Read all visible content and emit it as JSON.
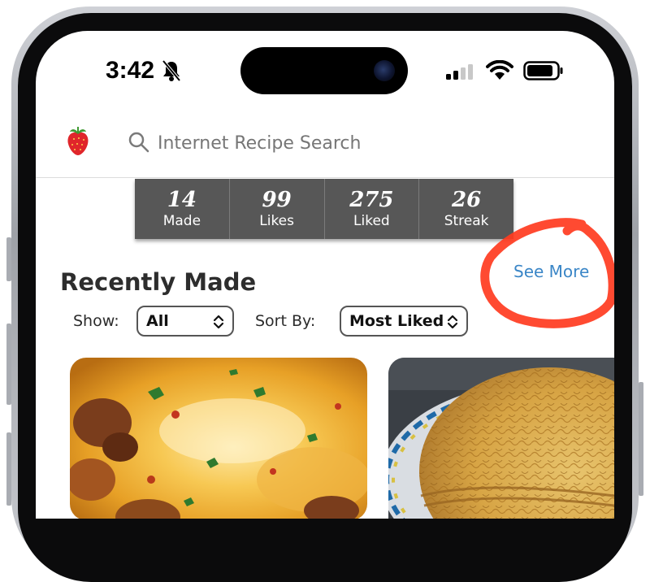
{
  "status_bar": {
    "time": "3:42",
    "icons": [
      "bell-slash-icon",
      "cellular-signal-icon",
      "wifi-icon",
      "battery-icon"
    ]
  },
  "header": {
    "logo": "strawberry-icon",
    "search_placeholder": "Internet Recipe Search"
  },
  "stats": [
    {
      "value": "14",
      "label": "Made"
    },
    {
      "value": "99",
      "label": "Likes"
    },
    {
      "value": "275",
      "label": "Liked"
    },
    {
      "value": "26",
      "label": "Streak"
    }
  ],
  "recent": {
    "title": "Recently Made",
    "see_more": "See More",
    "show_label": "Show:",
    "show_value": "All",
    "sort_label": "Sort By:",
    "sort_value": "Most Liked"
  },
  "colors": {
    "stats_bg": "#575757",
    "link": "#3a86c7",
    "annotation": "#ff3b1f"
  }
}
